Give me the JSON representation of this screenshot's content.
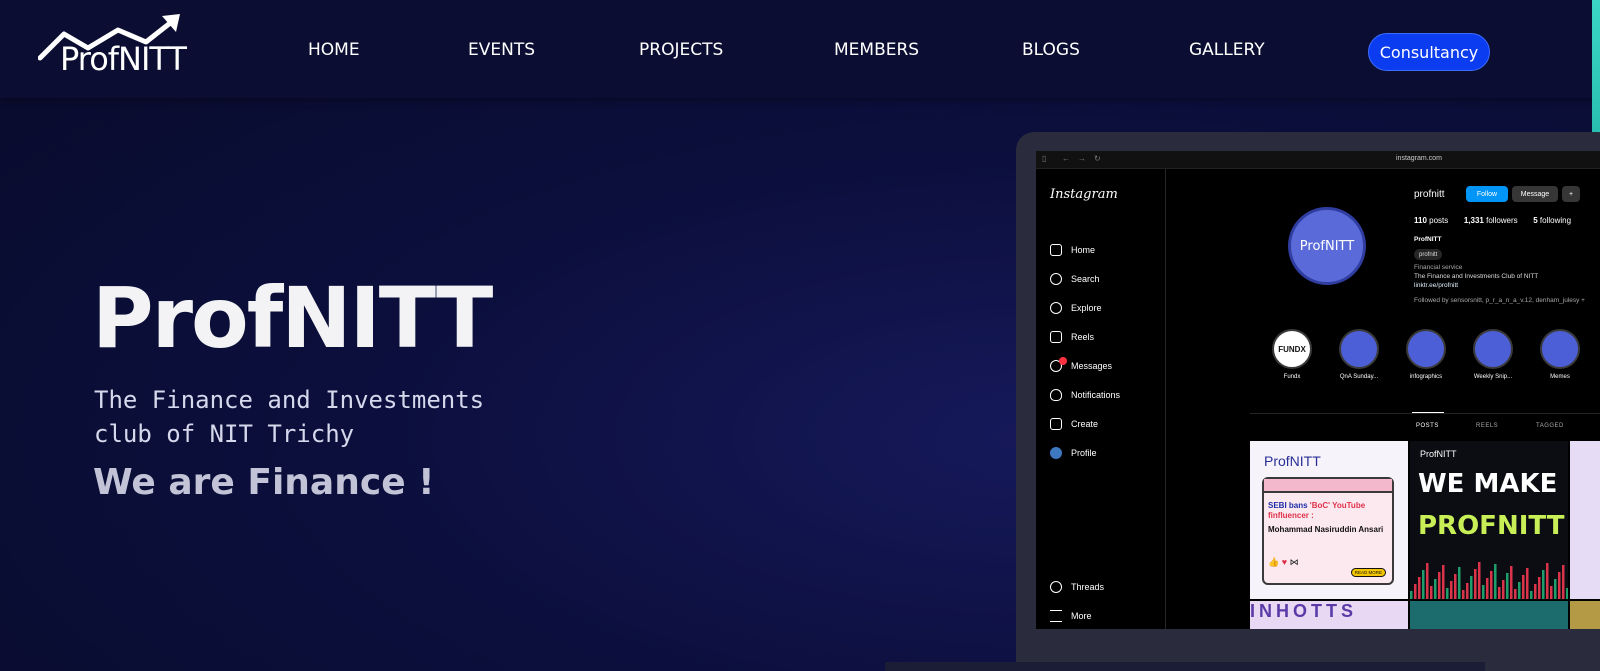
{
  "nav": {
    "logo_text": "ProfNITT",
    "links": [
      "HOME",
      "EVENTS",
      "PROJECTS",
      "MEMBERS",
      "BLOGS",
      "GALLERY"
    ],
    "cta": "Consultancy"
  },
  "hero": {
    "title": "ProfNITT",
    "subtitle": "The Finance and Investments club of NIT Trichy",
    "tagline": "We are  Finance !"
  },
  "instagram": {
    "url": "instagram.com",
    "brand": "Instagram",
    "sidebar": [
      "Home",
      "Search",
      "Explore",
      "Reels",
      "Messages",
      "Notifications",
      "Create",
      "Profile"
    ],
    "sidebar_bottom": [
      "Threads",
      "More"
    ],
    "messages_badge": "6",
    "username": "profnitt",
    "follow_label": "Follow",
    "message_label": "Message",
    "posts_count": "110",
    "posts_word": "posts",
    "followers_count": "1,331",
    "followers_word": "followers",
    "following_count": "5",
    "following_word": "following",
    "display_name": "ProfNITT",
    "threads_chip": "profnitt",
    "category": "Financial service",
    "bio": "The Finance and Investments Club of NITT",
    "link": "linktr.ee/profnitt",
    "followed_by": "Followed by sensorsnitt, p_r_a_n_a_v.12, denham_julesy +",
    "highlights": [
      "Fundx",
      "QnA Sunday...",
      "infographics",
      "Weekly Snip...",
      "Memes"
    ],
    "fundx_badge": "FUNDX",
    "tabs": [
      "POSTS",
      "REELS",
      "TAGGED"
    ],
    "post1": {
      "logo": "ProfNITT",
      "headline_a": "SEBI bans ",
      "headline_b": "'BoC' YouTube finfluencer :",
      "name": "Mohammad Nasiruddin Ansari",
      "read_more": "READ MORE"
    },
    "post2": {
      "logo": "ProfNITT",
      "line1": "WE MAKE",
      "line2": "PROFNITT"
    },
    "post_row2_text": "INHOTTS"
  }
}
